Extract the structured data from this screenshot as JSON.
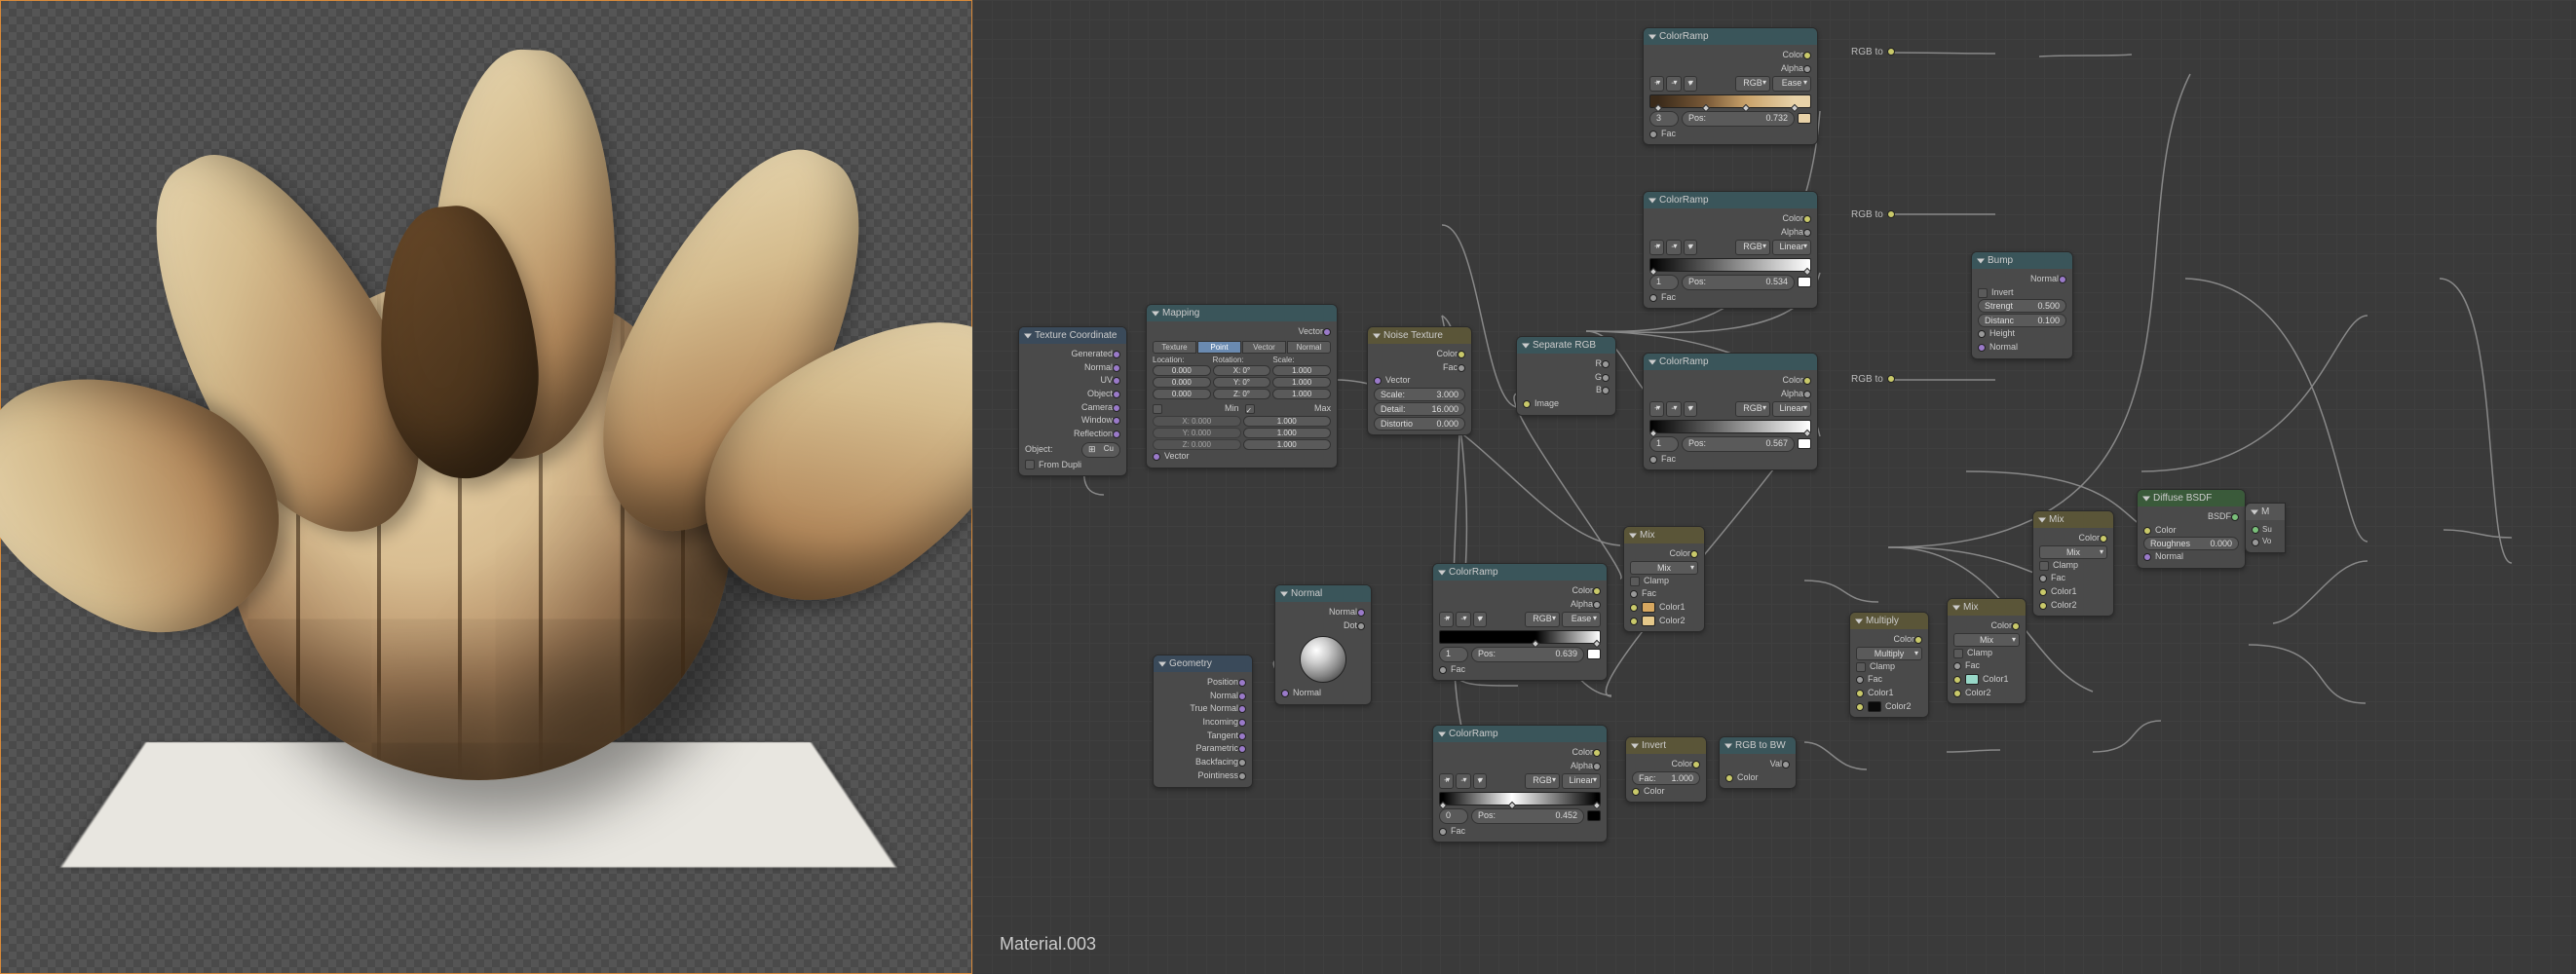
{
  "material_name": "Material.003",
  "tex_coord": {
    "title": "Texture Coordinate",
    "outputs": [
      "Generated",
      "Normal",
      "UV",
      "Object",
      "Camera",
      "Window",
      "Reflection"
    ],
    "object_label": "Object:",
    "from_dupli": "From Dupli"
  },
  "mapping": {
    "title": "Mapping",
    "modes": [
      "Texture",
      "Point",
      "Vector",
      "Normal"
    ],
    "active_mode": 1,
    "cols": [
      "Location:",
      "Rotation:",
      "Scale:"
    ],
    "loc": [
      "0.000",
      "0.000",
      "0.000"
    ],
    "rot": [
      "X: 0°",
      "Y: 0°",
      "Z: 0°"
    ],
    "scale": [
      "1.000",
      "1.000",
      "1.000"
    ],
    "min_label": "Min",
    "max_label": "Max",
    "min_xyz": [
      "X: 0.000",
      "Y: 0.000",
      "Z: 0.000"
    ],
    "max_xyz": [
      "1.000",
      "1.000",
      "1.000"
    ],
    "out": "Vector",
    "in": "Vector"
  },
  "noise": {
    "title": "Noise Texture",
    "out_color": "Color",
    "out_fac": "Fac",
    "in_vector": "Vector",
    "scale": {
      "label": "Scale:",
      "value": "3.000"
    },
    "detail": {
      "label": "Detail:",
      "value": "16.000"
    },
    "distortion": {
      "label": "Distortio",
      "value": "0.000"
    }
  },
  "separate_rgb": {
    "title": "Separate RGB",
    "outs": [
      "R",
      "G",
      "B"
    ],
    "in": "Image"
  },
  "geometry": {
    "title": "Geometry",
    "outputs": [
      "Position",
      "Normal",
      "True Normal",
      "Incoming",
      "Tangent",
      "Parametric",
      "Backfacing",
      "Pointiness"
    ]
  },
  "normal_node": {
    "title": "Normal",
    "out_normal": "Normal",
    "out_dot": "Dot",
    "in_normal": "Normal"
  },
  "colorramps": {
    "cr1": {
      "title": "ColorRamp",
      "interp": "RGB",
      "mode": "Ease",
      "index": "3",
      "pos": "0.732",
      "stops": [
        {
          "p": 5,
          "c": "#3a2a1a"
        },
        {
          "p": 35,
          "c": "#7a5a38"
        },
        {
          "p": 60,
          "c": "#c9a26a"
        },
        {
          "p": 90,
          "c": "#E8D2A8"
        }
      ]
    },
    "cr2": {
      "title": "ColorRamp",
      "interp": "RGB",
      "mode": "Linear",
      "index": "1",
      "pos": "0.534",
      "stops": [
        {
          "p": 2,
          "c": "#000"
        },
        {
          "p": 98,
          "c": "#fff"
        }
      ]
    },
    "cr3": {
      "title": "ColorRamp",
      "interp": "RGB",
      "mode": "Linear",
      "index": "1",
      "pos": "0.567",
      "stops": [
        {
          "p": 2,
          "c": "#000"
        },
        {
          "p": 98,
          "c": "#fff"
        }
      ]
    },
    "cr4": {
      "title": "ColorRamp",
      "interp": "RGB",
      "mode": "Ease",
      "index": "1",
      "pos": "0.639",
      "stops": [
        {
          "p": 60,
          "c": "#000"
        },
        {
          "p": 98,
          "c": "#fff"
        }
      ]
    },
    "cr5": {
      "title": "ColorRamp",
      "interp": "RGB",
      "mode": "Linear",
      "index": "0",
      "pos": "0.452",
      "stops": [
        {
          "p": 2,
          "c": "#000"
        },
        {
          "p": 45,
          "c": "#fff"
        },
        {
          "p": 98,
          "c": "#000"
        }
      ]
    }
  },
  "mix1": {
    "title": "Mix",
    "blend": "Mix",
    "clamp": "Clamp",
    "fac": "Fac",
    "c1_label": "Color1",
    "c2_label": "Color2",
    "c1": "#D8A860",
    "c2": "#E5C88A",
    "out": "Color"
  },
  "mix2": {
    "title": "Mix",
    "blend": "Mix",
    "clamp": "Clamp",
    "fac": "Fac",
    "c1_label": "Color1",
    "c2_label": "Color2",
    "c1": "#98D8C8",
    "c2": "#98D8C8",
    "out": "Color"
  },
  "multiply": {
    "title": "Multiply",
    "blend": "Multiply",
    "clamp": "Clamp",
    "fac": "Fac",
    "c1_label": "Color1",
    "c2_label": "Color2",
    "c2": "#0a0a0a",
    "out": "Color"
  },
  "mix3": {
    "title": "Mix",
    "blend": "Mix",
    "clamp": "Clamp",
    "fac": "Fac",
    "c1_label": "Color1",
    "c2_label": "Color2",
    "out": "Color"
  },
  "invert": {
    "title": "Invert",
    "out": "Color",
    "fac": {
      "label": "Fac:",
      "value": "1.000"
    },
    "in_color": "Color"
  },
  "rgb_to_bw": {
    "title": "RGB to BW",
    "out": "Val",
    "in": "Color"
  },
  "bump": {
    "title": "Bump",
    "out": "Normal",
    "invert": "Invert",
    "strength": {
      "label": "Strengt",
      "value": "0.500"
    },
    "distance": {
      "label": "Distanc",
      "value": "0.100"
    },
    "height": "Height",
    "in_normal": "Normal"
  },
  "diffuse": {
    "title": "Diffuse BSDF",
    "out": "BSDF",
    "color": "Color",
    "roughness": {
      "label": "Roughnes",
      "value": "0.000"
    },
    "normal": "Normal"
  },
  "rgb_to": "RGB to"
}
